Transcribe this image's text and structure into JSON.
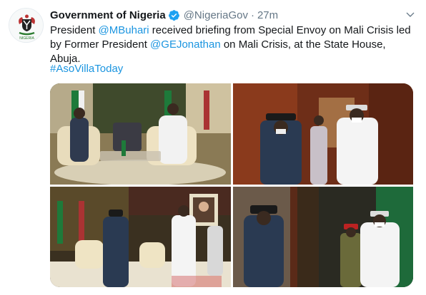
{
  "account": {
    "display_name": "Government of Nigeria",
    "handle": "@NigeriaGov",
    "separator": "·",
    "time": "27m",
    "avatar_caption": "NIGERIA"
  },
  "tweet": {
    "part1": "President ",
    "mention1": "@MBuhari",
    "part2": " received briefing from Special Envoy on Mali Crisis led by Former President ",
    "mention2": "@GEJonathan",
    "part3": " on Mali Crisis, at the State House, Abuja.",
    "hashtag": "#AsoVillaToday"
  },
  "colors": {
    "link": "#1b95e0",
    "verified": "#1da1f2",
    "text": "#14171a",
    "muted": "#657786"
  },
  "icons": {
    "verified": "verified-badge-icon",
    "menu": "chevron-down-icon"
  },
  "media": {
    "photos": [
      {
        "name": "photo-1"
      },
      {
        "name": "photo-2"
      },
      {
        "name": "photo-3"
      },
      {
        "name": "photo-4"
      }
    ]
  }
}
